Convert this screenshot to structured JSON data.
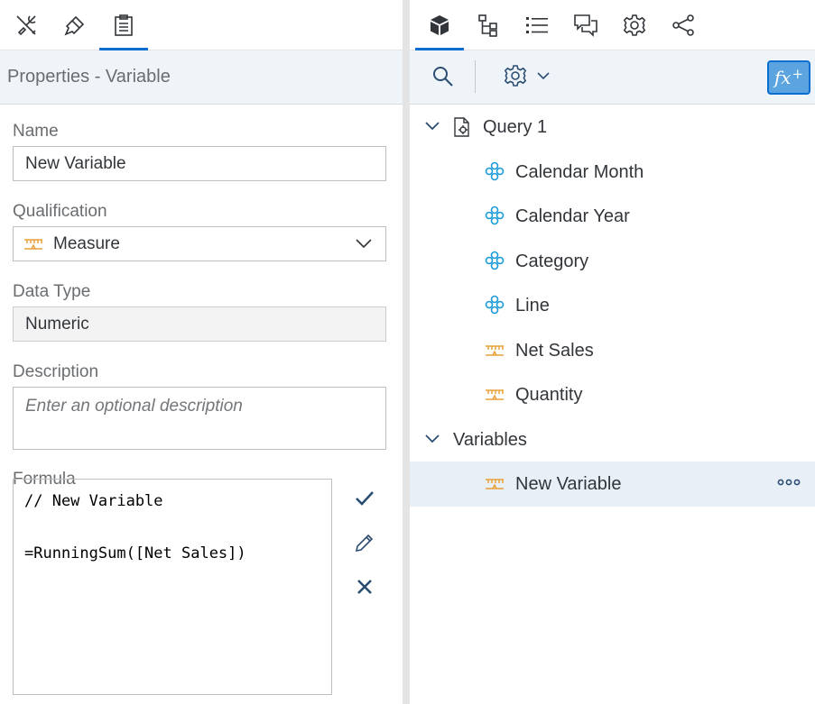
{
  "left_panel": {
    "tabs": [
      "tools-icon",
      "brush-icon",
      "clipboard-icon"
    ],
    "header": "Properties - Variable",
    "name_label": "Name",
    "name_value": "New Variable",
    "qualification_label": "Qualification",
    "qualification_value": "Measure",
    "data_type_label": "Data Type",
    "data_type_value": "Numeric",
    "description_label": "Description",
    "description_placeholder": "Enter an optional description",
    "formula_label": "Formula",
    "formula_line1": "// New Variable",
    "formula_line2": "=RunningSum([Net Sales])"
  },
  "right_panel": {
    "tabs": [
      "cube-icon",
      "hierarchy-icon",
      "list-icon",
      "comments-icon",
      "settings-icon",
      "share-icon"
    ],
    "fx_label": "fx",
    "fx_plus": "+",
    "tree": {
      "query": "Query 1",
      "query_items": [
        "Calendar Month",
        "Calendar Year",
        "Category",
        "Line",
        "Net Sales",
        "Quantity"
      ],
      "variables_group": "Variables",
      "variable_items": [
        "New Variable"
      ]
    }
  },
  "colors": {
    "accent": "#0a6ed1",
    "dimension": "#1a9bd7",
    "measure": "#e8a13a",
    "header_bg": "#eff4f9",
    "selected_bg": "#e8eff6",
    "icon": "#32363a"
  }
}
